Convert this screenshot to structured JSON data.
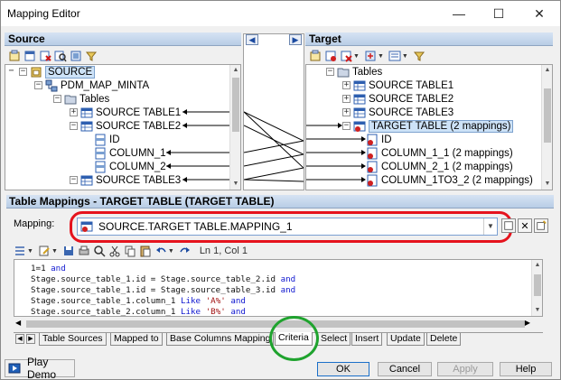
{
  "window": {
    "title": "Mapping Editor"
  },
  "source_panel": {
    "title": "Source",
    "tree": [
      {
        "label": "SOURCE",
        "level": 0
      },
      {
        "label": "PDM_MAP_MINTA",
        "level": 1
      },
      {
        "label": "Tables",
        "level": 2
      },
      {
        "label": "SOURCE TABLE1",
        "level": 3
      },
      {
        "label": "SOURCE TABLE2",
        "level": 3
      },
      {
        "label": "ID",
        "level": 4
      },
      {
        "label": "COLUMN_1",
        "level": 4
      },
      {
        "label": "COLUMN_2",
        "level": 4
      },
      {
        "label": "SOURCE TABLE3",
        "level": 3
      }
    ]
  },
  "target_panel": {
    "title": "Target",
    "tree": [
      {
        "label": "Tables"
      },
      {
        "label": "SOURCE TABLE1"
      },
      {
        "label": "SOURCE TABLE2"
      },
      {
        "label": "SOURCE TABLE3"
      },
      {
        "label": "TARGET TABLE (2 mappings)"
      },
      {
        "label": "ID"
      },
      {
        "label": "COLUMN_1_1 (2 mappings)"
      },
      {
        "label": "COLUMN_2_1 (2 mappings)"
      },
      {
        "label": "COLUMN_1TO3_2 (2 mappings)"
      }
    ]
  },
  "table_mappings": {
    "title": "Table Mappings - TARGET TABLE (TARGET TABLE)",
    "mapping_label": "Mapping:",
    "mapping_value": "SOURCE.TARGET TABLE.MAPPING_1",
    "cursor_pos": "Ln 1, Col 1"
  },
  "code": [
    [
      {
        "t": "1=1 "
      },
      {
        "t": "and",
        "k": 1
      }
    ],
    [
      {
        "t": "Stage.source_table_1.id = Stage.source_table_2.id "
      },
      {
        "t": "and",
        "k": 1
      }
    ],
    [
      {
        "t": "Stage.source_table_1.id = Stage.source_table_3.id "
      },
      {
        "t": "and",
        "k": 1
      }
    ],
    [
      {
        "t": "Stage.source_table_1.column_1 "
      },
      {
        "t": "Like",
        "k": 1
      },
      {
        "t": " "
      },
      {
        "t": "'A%'",
        "s": 1
      },
      {
        "t": " "
      },
      {
        "t": "and",
        "k": 1
      }
    ],
    [
      {
        "t": "Stage.source_table_2.column_1 "
      },
      {
        "t": "Like",
        "k": 1
      },
      {
        "t": " "
      },
      {
        "t": "'B%'",
        "s": 1
      },
      {
        "t": " "
      },
      {
        "t": "and",
        "k": 1
      }
    ]
  ],
  "tabs": [
    "Table Sources",
    "Mapped to",
    "Base Columns Mapping",
    "Criteria",
    "Select",
    "Insert",
    "Update",
    "Delete"
  ],
  "active_tab": "Criteria",
  "buttons": {
    "play_demo": "Play Demo",
    "ok": "OK",
    "cancel": "Cancel",
    "apply": "Apply",
    "help": "Help"
  },
  "colors": {
    "annotation_red": "#e5131d",
    "annotation_green": "#1fa32e",
    "panel_header": "#c7d8ee",
    "selection": "#cde2f7"
  }
}
